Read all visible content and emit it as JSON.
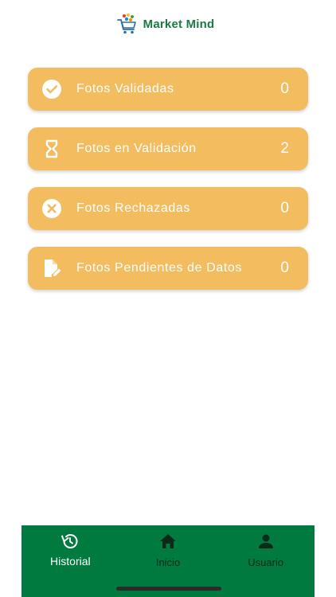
{
  "header": {
    "title": "Market Mind",
    "logo_icon": "shopping-cart-logo-icon"
  },
  "cards": [
    {
      "label": "Fotos Validadas",
      "count": "0",
      "icon": "check-circle-icon"
    },
    {
      "label": "Fotos en Validación",
      "count": "2",
      "icon": "hourglass-icon"
    },
    {
      "label": "Fotos Rechazadas",
      "count": "0",
      "icon": "cancel-circle-icon"
    },
    {
      "label": "Fotos Pendientes de Datos",
      "count": "0",
      "icon": "document-edit-icon"
    }
  ],
  "bottom_nav": {
    "items": [
      {
        "label": "Historial",
        "icon": "history-icon",
        "active": true
      },
      {
        "label": "Inicio",
        "icon": "home-icon",
        "active": false
      },
      {
        "label": "Usuario",
        "icon": "person-icon",
        "active": false
      }
    ]
  },
  "colors": {
    "brand_green": "#007a3f",
    "title_green": "#1a7a45",
    "card_orange": "#f2bc5f"
  }
}
